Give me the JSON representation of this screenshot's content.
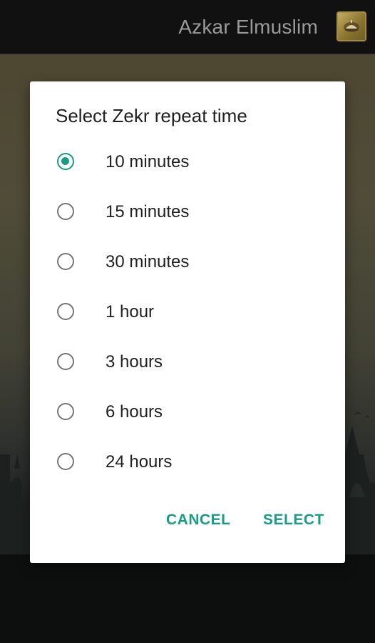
{
  "app": {
    "title": "Azkar Elmuslim",
    "logo_icon": "mosque-logo-icon"
  },
  "dialog": {
    "title": "Select Zekr repeat time",
    "selected_index": 0,
    "accent_color": "#199c86",
    "options": [
      {
        "label": "10 minutes",
        "checked": true
      },
      {
        "label": "15 minutes",
        "checked": false
      },
      {
        "label": "30 minutes",
        "checked": false
      },
      {
        "label": "1 hour",
        "checked": false
      },
      {
        "label": "3 hours",
        "checked": false
      },
      {
        "label": "6 hours",
        "checked": false
      },
      {
        "label": "24 hours",
        "checked": false
      }
    ],
    "cancel_label": "CANCEL",
    "select_label": "SELECT"
  }
}
